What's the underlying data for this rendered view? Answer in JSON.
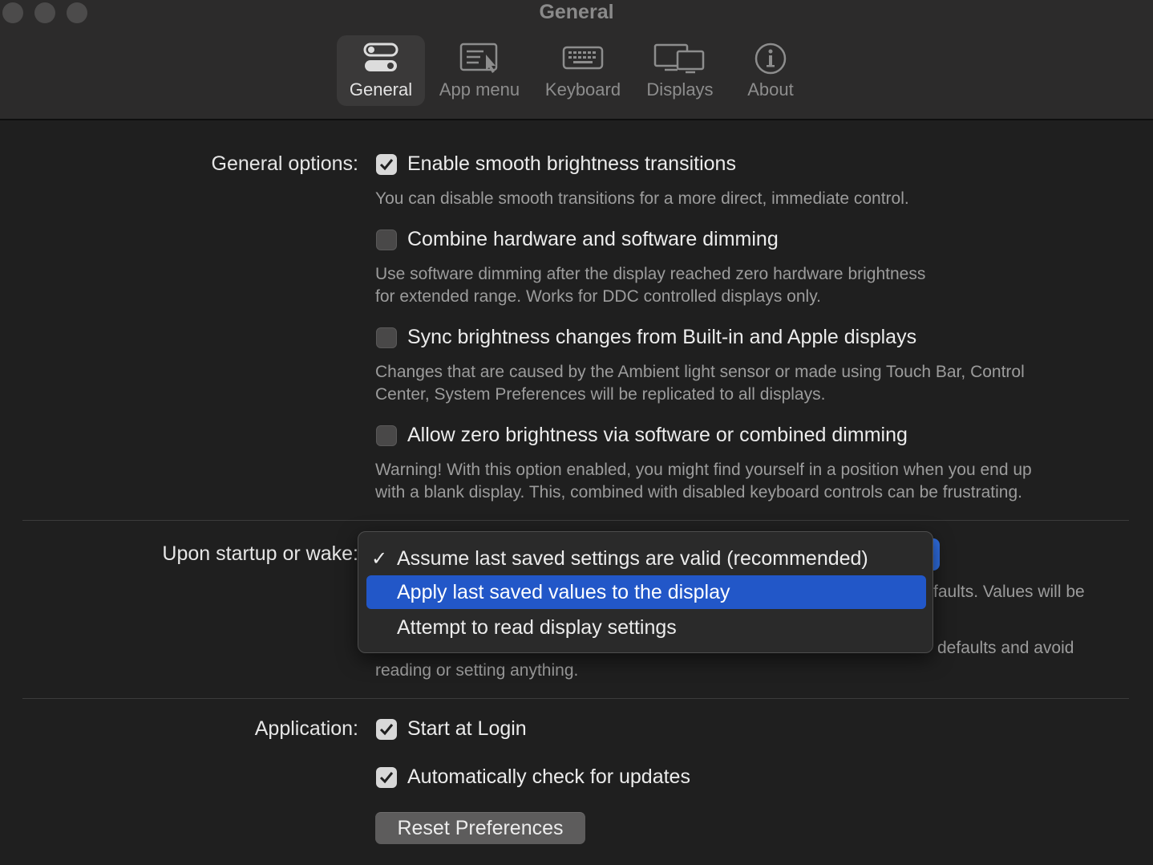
{
  "window": {
    "title": "General"
  },
  "toolbar": {
    "tabs": [
      {
        "label": "General",
        "icon": "toggle-switches-icon",
        "active": true
      },
      {
        "label": "App menu",
        "icon": "menu-list-icon",
        "active": false
      },
      {
        "label": "Keyboard",
        "icon": "keyboard-icon",
        "active": false
      },
      {
        "label": "Displays",
        "icon": "displays-icon",
        "active": false
      },
      {
        "label": "About",
        "icon": "info-icon",
        "active": false
      }
    ]
  },
  "general": {
    "label": "General options:",
    "options": [
      {
        "label": "Enable smooth brightness transitions",
        "checked": true,
        "desc": [
          "You can disable smooth transitions for a more direct, immediate control."
        ]
      },
      {
        "label": "Combine hardware and software dimming",
        "checked": false,
        "desc": [
          "Use software dimming after the display reached zero hardware brightness",
          "for extended range. Works for DDC controlled displays only."
        ]
      },
      {
        "label": "Sync brightness changes from Built-in and Apple displays",
        "checked": false,
        "desc": [
          "Changes that are caused by the Ambient light sensor or made using Touch Bar, Control",
          "Center, System Preferences will be replicated to all displays."
        ]
      },
      {
        "label": "Allow zero brightness via software or combined dimming",
        "checked": false,
        "desc": [
          "Warning! With this option enabled, you might find yourself in a position when you end up",
          "with a blank display. This, combined with disabled keyboard controls can be frustrating."
        ]
      }
    ]
  },
  "startup": {
    "label": "Upon startup or wake:",
    "desc_fragment_1": "faults. Values will be",
    "desc_fragment_2": "defaults and avoid",
    "desc_line_2": "reading or setting anything.",
    "menu": {
      "items": [
        {
          "label": "Assume last saved settings are valid (recommended)",
          "checked": true,
          "highlighted": false
        },
        {
          "label": "Apply last saved values to the display",
          "checked": false,
          "highlighted": true
        },
        {
          "label": "Attempt to read display settings",
          "checked": false,
          "highlighted": false
        }
      ],
      "check_glyph": "✓"
    }
  },
  "application": {
    "label": "Application:",
    "options": [
      {
        "label": "Start at Login",
        "checked": true
      },
      {
        "label": "Automatically check for updates",
        "checked": true
      }
    ],
    "reset_label": "Reset Preferences"
  },
  "colors": {
    "accent": "#2257c8",
    "background": "#1f1f1f",
    "toolbar": "#2c2b2b"
  }
}
